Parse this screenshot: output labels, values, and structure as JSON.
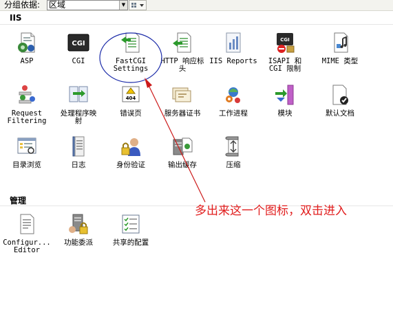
{
  "toolbar": {
    "group_label": "分组依据:",
    "group_value": "区域"
  },
  "sections": {
    "iis": "IIS",
    "manage": "管理"
  },
  "features": {
    "asp": "ASP",
    "cgi": "CGI",
    "fastcgi": "FastCGI\nSettings",
    "http": "HTTP 响应标\n头",
    "iis_reports": "IIS Reports",
    "isapi": "ISAPI 和\nCGI 限制",
    "mime": "MIME 类型",
    "request_filtering": "Request\nFiltering",
    "handlers": "处理程序映\n射",
    "error_pages": "错误页",
    "server_cert": "服务器证书",
    "worker_process": "工作进程",
    "modules": "模块",
    "default_doc": "默认文档",
    "dir_browse": "目录浏览",
    "logging": "日志",
    "auth": "身份验证",
    "output_cache": "输出缓存",
    "compression": "压缩",
    "config_editor": "Configur...\nEditor",
    "feature_delegation": "功能委派",
    "shared_config": "共享的配置"
  },
  "icons": {
    "cgi_text": "CGI",
    "error_code": "404",
    "isapi_text": "CGI"
  },
  "annotation": {
    "text": "多出来这一个图标，双击进入",
    "color": "#e11d1d"
  }
}
